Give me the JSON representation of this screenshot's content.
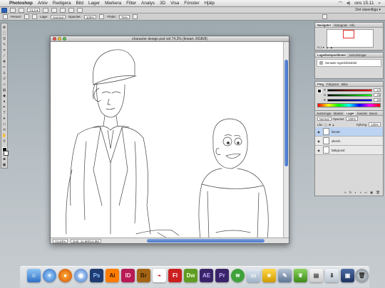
{
  "menubar": {
    "app_name": "Photoshop",
    "items": [
      "Arkiv",
      "Redigera",
      "Bild",
      "Lager",
      "Markera",
      "Filter",
      "Analys",
      "3D",
      "Visa",
      "Fönster",
      "Hjälp"
    ],
    "clock": "ons 15.11",
    "workspace": "Det väsentliga ▾"
  },
  "options_bar": {
    "zoom": "74,3 ▾"
  },
  "brush_bar": {
    "brush_label": "Pensel:",
    "mode_label": "Läge:",
    "mode_value": "Normal",
    "opacity_label": "Opacitet:",
    "opacity_value": "100%",
    "flow_label": "Flöde:",
    "flow_value": "75%"
  },
  "document": {
    "title": "character design.psd vid 74,3% (lineart, RGB/8)",
    "zoom": "74,34%",
    "doc_info": "Dok: 11,6M/14,8M"
  },
  "navigator": {
    "tabs": [
      "Navigator",
      "Histogram",
      "Info"
    ]
  },
  "history": {
    "tabs": [
      "Lagerkompositioner",
      "Anteckningar"
    ],
    "row_text": "Senaste ögonblicksbild"
  },
  "color": {
    "tabs": [
      "Färg",
      "Färgrutor",
      "Stilar"
    ],
    "channels": [
      {
        "label": "R",
        "value": "17"
      },
      {
        "label": "G",
        "value": "25"
      },
      {
        "label": "B",
        "value": "42"
      }
    ]
  },
  "layers": {
    "tabs": [
      "Justeringar",
      "Masker",
      "Lager",
      "Kanaler",
      "Banor"
    ],
    "blend_mode": "Normal",
    "opacity_label": "Opacitet:",
    "opacity_value": "100%",
    "lock_label": "Lås:",
    "fill_label": "Fyllning:",
    "fill_value": "100%",
    "rows": [
      {
        "name": "lineart",
        "selected": true
      },
      {
        "name": "sketch",
        "selected": false
      },
      {
        "name": "Bakgrund",
        "selected": false
      }
    ]
  },
  "dock": {
    "apps": [
      "Ps",
      "Ai",
      "ID",
      "Br",
      "Fl",
      "Dw",
      "AE",
      "Pr"
    ]
  },
  "colors": {
    "accent": "#3f6fc5",
    "photoshop": "#1e3b72",
    "illustrator": "#ff7c00",
    "indesign": "#b81a54",
    "bridge": "#a36515",
    "flash": "#cc1f1f",
    "dreamweaver": "#5f9c21",
    "aftereffects": "#3a2469",
    "premiere": "#3a2469"
  }
}
